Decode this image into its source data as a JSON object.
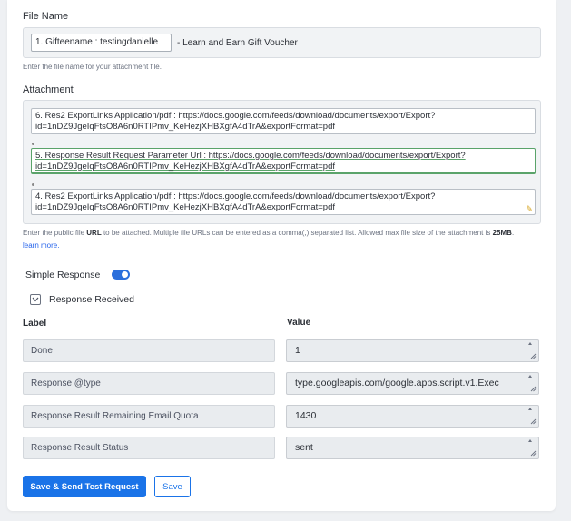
{
  "file_name": {
    "label": "File Name",
    "chip": "1. Gifteename : testingdanielle",
    "suffix": "- Learn and Earn Gift Voucher",
    "help": "Enter the file name for your attachment file."
  },
  "attachment": {
    "label": "Attachment",
    "items": [
      {
        "line1": "6. Res2 ExportLinks Application/pdf : https://docs.google.com/feeds/download/documents/export/Export?",
        "line2": "id=1nDZ9JgeIqFtsO8A6n0RTIPmv_KeHezjXHBXgfA4dTrA&exportFormat=pdf"
      },
      {
        "line1": "5. Response Result Request Parameter Url : https://docs.google.com/feeds/download/documents/export/Export?",
        "line2": "id=1nDZ9JgeIqFtsO8A6n0RTIPmv_KeHezjXHBXgfA4dTrA&exportFormat=pdf"
      },
      {
        "line1": "4. Res2 ExportLinks Application/pdf : https://docs.google.com/feeds/download/documents/export/Export?",
        "line2": "id=1nDZ9JgeIqFtsO8A6n0RTIPmv_KeHezjXHBXgfA4dTrA&exportFormat=pdf"
      }
    ],
    "help_prefix": "Enter the public file ",
    "help_bold_url": "URL",
    "help_middle": " to be attached. Multiple file URLs can be entered as a comma(,) separated list. Allowed max file size of the attachment is ",
    "help_bold_size": "25MB",
    "help_suffix": ".",
    "learn_more": "learn more."
  },
  "simple_response": {
    "label": "Simple Response",
    "enabled": true
  },
  "response_received": {
    "label": "Response Received",
    "col_label": "Label",
    "col_value": "Value",
    "rows": [
      {
        "label": "Done",
        "value": "1"
      },
      {
        "label": "Response @type",
        "value": "type.googleapis.com/google.apps.script.v1.Exec"
      },
      {
        "label": "Response Result Remaining Email Quota",
        "value": "1430"
      },
      {
        "label": "Response Result Status",
        "value": "sent"
      }
    ]
  },
  "buttons": {
    "save_send": "Save & Send Test Request",
    "save": "Save"
  },
  "colors": {
    "accent": "#1a73e8",
    "toggle_on": "#2b6fdc",
    "active_border": "#5aa36a"
  }
}
